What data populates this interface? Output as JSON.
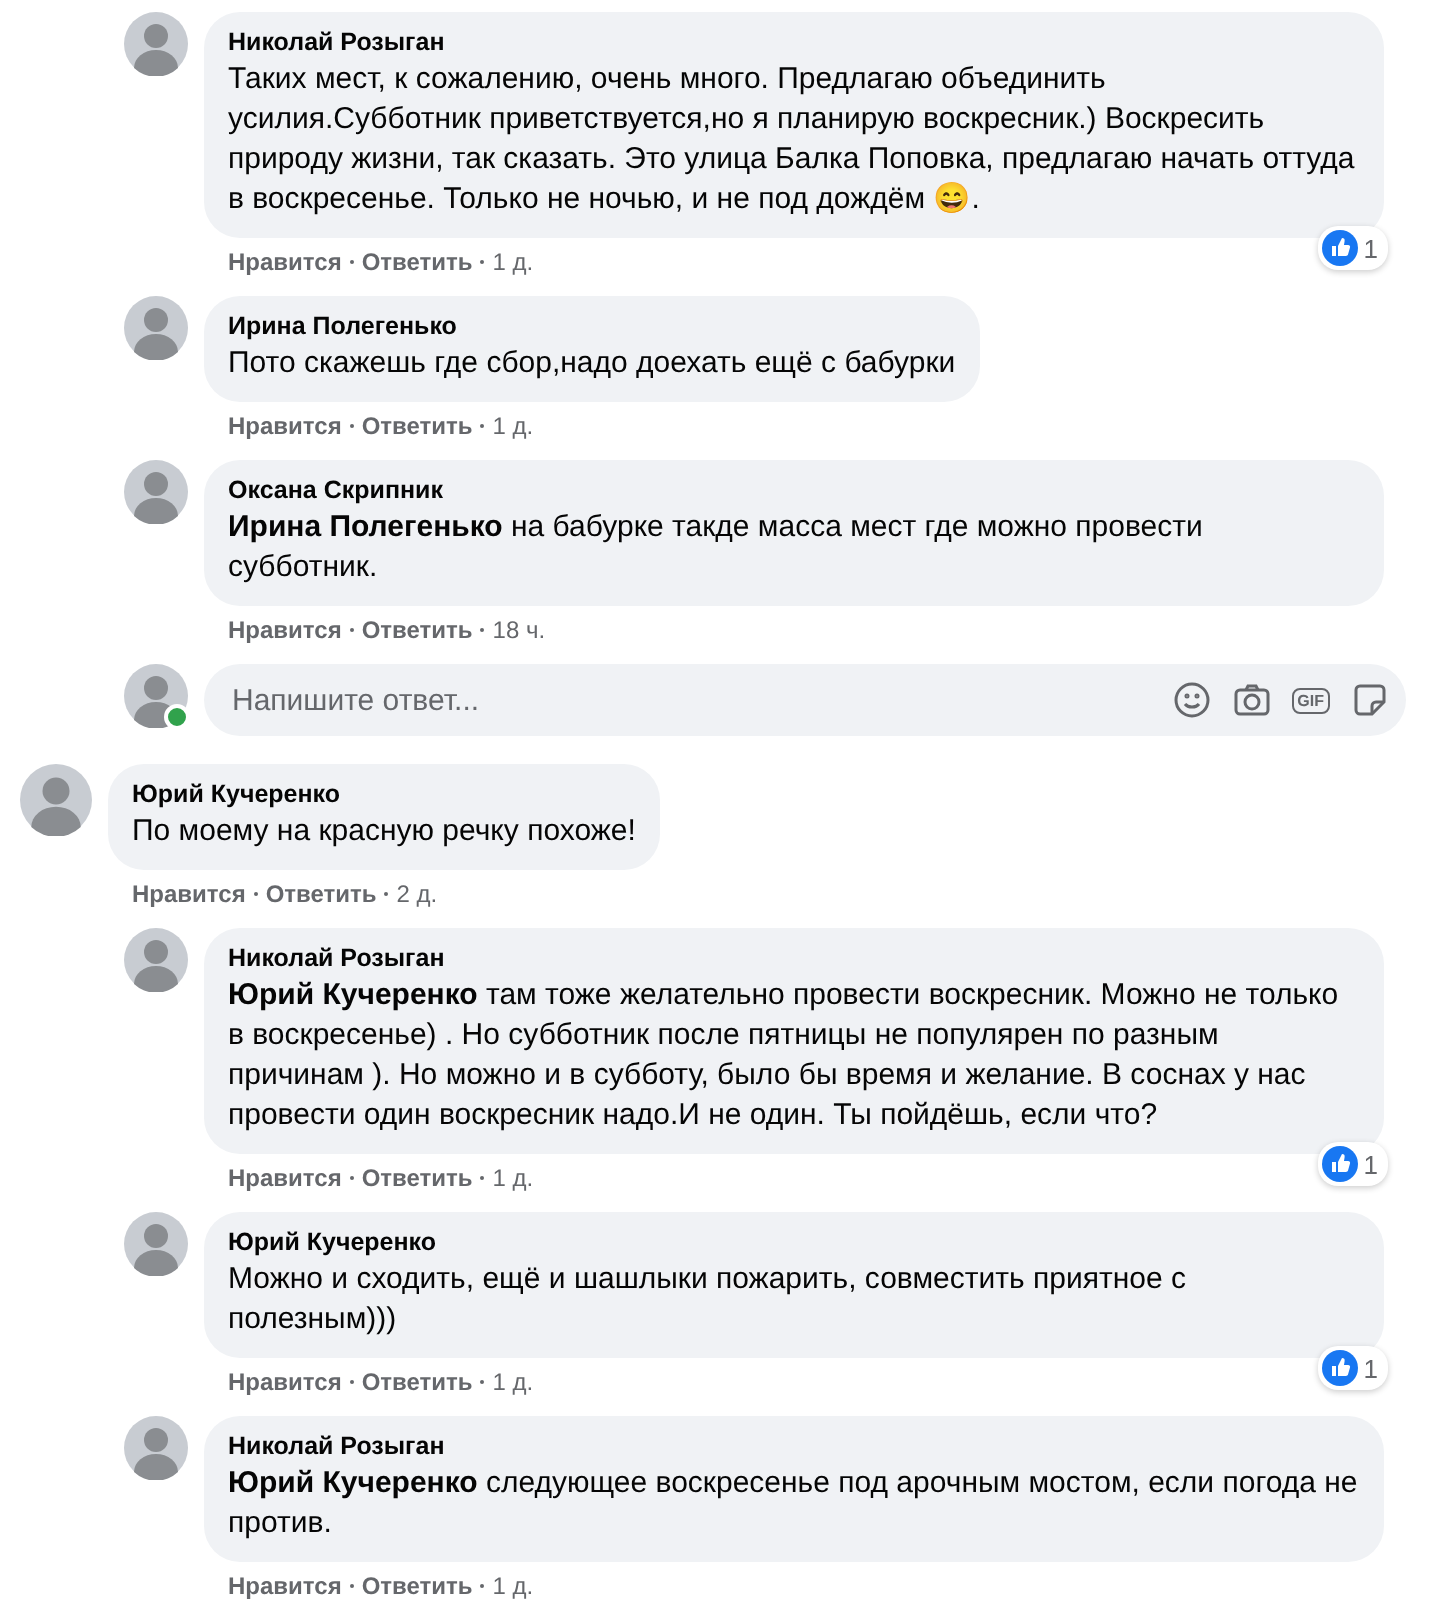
{
  "earlier_replies": [
    {
      "author": "Николай Розыган",
      "text": "Таких мест, к сожалению, очень много. Предлагаю объединить усилия.Субботник приветствуется,но я планирую воскресник.) Воскресить природу жизни, так сказать. Это улица Балка Поповка, предлагаю начать оттуда в воскресенье. Только не ночью, и не под дождём 😄.",
      "like": "Нравится",
      "reply": "Ответить",
      "time": "1 д.",
      "likes": "1"
    },
    {
      "author": "Ирина Полегенько",
      "text": "Пото скажешь где сбор,надо доехать ещё с бабурки",
      "like": "Нравится",
      "reply": "Ответить",
      "time": "1 д."
    },
    {
      "author": "Оксана Скрипник",
      "text": "**Ирина Полегенько** на бабурке такде масса мест где можно провести субботник.",
      "like": "Нравится",
      "reply": "Ответить",
      "time": "18 ч."
    }
  ],
  "reply_box": {
    "placeholder": "Напишите ответ...",
    "online": true,
    "gif_label": "GIF"
  },
  "comment": {
    "author": "Юрий Кучеренко",
    "text": "По моему на красную речку похоже!",
    "like": "Нравится",
    "reply": "Ответить",
    "time": "2 д.",
    "children": [
      {
        "author": "Николай Розыган",
        "text": "**Юрий Кучеренко** там тоже желательно провести воскресник. Можно не только в воскресенье) . Но субботник после пятницы не популярен по разным причинам ). Но можно и в субботу, было бы время и желание. В соснах у нас провести один воскресник надо.И не один. Ты пойдёшь, если что?",
        "like": "Нравится",
        "reply": "Ответить",
        "time": "1 д.",
        "likes": "1"
      },
      {
        "author": "Юрий Кучеренко",
        "text": "Можно и сходить, ещё и шашлыки пожарить, совместить приятное с полезным)))",
        "like": "Нравится",
        "reply": "Ответить",
        "time": "1 д.",
        "likes": "1"
      },
      {
        "author": "Николай Розыган",
        "text": "**Юрий Кучеренко** следующее воскресенье под арочным мостом, если погода не против.",
        "like": "Нравится",
        "reply": "Ответить",
        "time": "1 д."
      }
    ]
  }
}
